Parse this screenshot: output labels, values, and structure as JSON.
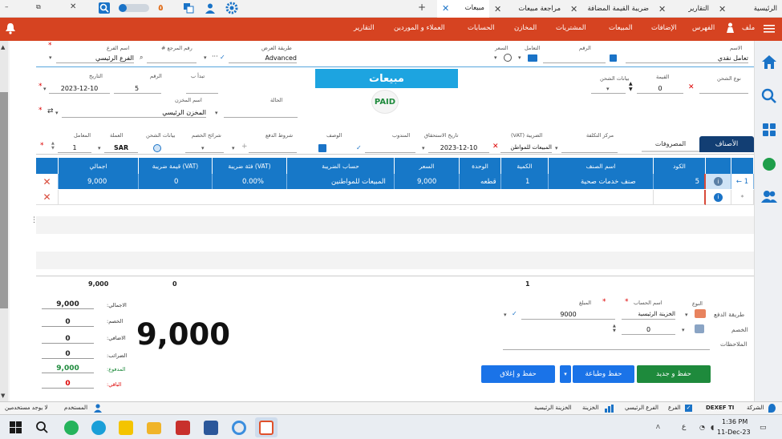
{
  "tabs": [
    {
      "label": "الرئيسية",
      "active": false
    },
    {
      "label": "التقارير",
      "active": false
    },
    {
      "label": "ضريبة القيمة المضافة",
      "active": false
    },
    {
      "label": "مراجعة مبيعات",
      "active": false
    },
    {
      "label": "مبيعات",
      "active": true
    }
  ],
  "toolbar_badges": {
    "notif": "٥",
    "msg": "2"
  },
  "menu": {
    "file": "ملف",
    "index": "الفهرس",
    "reports_small": "الإضافات",
    "sales": "المبيعات",
    "purchases": "المشتريات",
    "stores": "المخازن",
    "accounts": "الحسابات",
    "customers": "العملاء و الموردين",
    "reports": "التقارير"
  },
  "header": {
    "name_label": "الاسم",
    "name_value": "تعامل نقدي",
    "number_label": "الرقم",
    "dealing_label": "التعامل",
    "price_label": "السعر",
    "display_label": "طريقة العرض",
    "display_value": "Advanced",
    "ref_label": "رقم المرجع #",
    "branch_label": "اسم الفرع",
    "branch_value": "الفرع الرئيسي",
    "shipping_type_label": "نوع الشحن",
    "value_label": "القيمة",
    "value_value": "0",
    "shipping_data_label": "بيانات الشحن",
    "title": "مبيعات",
    "paid": "PAID",
    "starts_label": "تبدأ ب",
    "number2_label": "الرقم",
    "number2_value": "5",
    "date_label": "التاريخ",
    "date_value": "2023-12-10",
    "status_label": "الحالة",
    "store_label": "اسم المخزن",
    "store_value": "المخزن الرئيسي"
  },
  "line_meta": {
    "cost_center": "مركز التكلفة",
    "tax": "الضريبة (VAT)",
    "tax_value": "المبيعات للمواطن",
    "due_date": "تاريخ الاستحقاق",
    "due_value": "2023-12-10",
    "rep": "المندوب",
    "desc": "الوصف",
    "pay_terms": "شروط الدفع",
    "discount_slices": "شرائح الخصم",
    "shipping_data": "بيانات الشحن",
    "currency": "العملة",
    "currency_value": "SAR",
    "rate": "المعامل",
    "rate_value": "1"
  },
  "subtabs": {
    "items": "الأصناف",
    "expenses": "المصروفات"
  },
  "grid": {
    "headers": [
      "الكود",
      "اسم الصنف",
      "الكمية",
      "الوحدة",
      "السعر",
      "حساب الضريبة",
      "فئة ضريبة (VAT)",
      "قيمة ضريبة (VAT)",
      "اجمالي"
    ],
    "row": {
      "index": "1",
      "code": "5",
      "name": "صنف خدمات صحية",
      "qty": "1",
      "unit": "قطعه",
      "price": "9,000",
      "tax_account": "المبيعات للمواطنين",
      "tax_rate": "0.00%",
      "tax_value": "0",
      "total": "9,000"
    },
    "new_row": "*"
  },
  "totals_row": {
    "total": "9,000",
    "tax": "0",
    "qty": "1"
  },
  "summary": {
    "total_label": "الاجمالي:",
    "total": "9,000",
    "discount_label": "الخصم:",
    "discount": "0",
    "extra_label": "الاضافي:",
    "extra": "0",
    "tax_label": "الضرائب:",
    "tax": "0",
    "paid_label": "المدفوع:",
    "paid": "9,000",
    "remaining_label": "الباقي:",
    "remaining": "0",
    "big_total": "9,000"
  },
  "payment": {
    "method_label": "طريقة الدفع",
    "type_label": "النوع",
    "account_label": "اسم الحساب",
    "account_value": "الخزينة الرئيسية",
    "amount_label": "المبلغ",
    "amount_value": "9000",
    "discount_label": "الخصم",
    "discount_value": "0",
    "notes_label": "الملاحظات"
  },
  "buttons": {
    "save_new": "حفظ و جديد",
    "save_print": "حفظ وطباعة",
    "save_close": "حفظ و إغلاق"
  },
  "status": {
    "company": "الشركة",
    "company_value": "DEXEF TI",
    "branch": "الفرع",
    "branch_value": "الفرع الرئيسي",
    "treasury": "الخزينة",
    "treasury_value": "الخزينة الرئيسية",
    "user": "المستخدم",
    "no_users": "لا يوجد مستخدمين"
  },
  "taskbar": {
    "time": "1:36 PM",
    "date": "11-Dec-23",
    "lang": "ع"
  },
  "colors": {
    "accent": "#d64321",
    "blue": "#1778c8",
    "green": "#1e8a3c",
    "btnblue": "#1a73e8",
    "remaining": "#d00000"
  }
}
